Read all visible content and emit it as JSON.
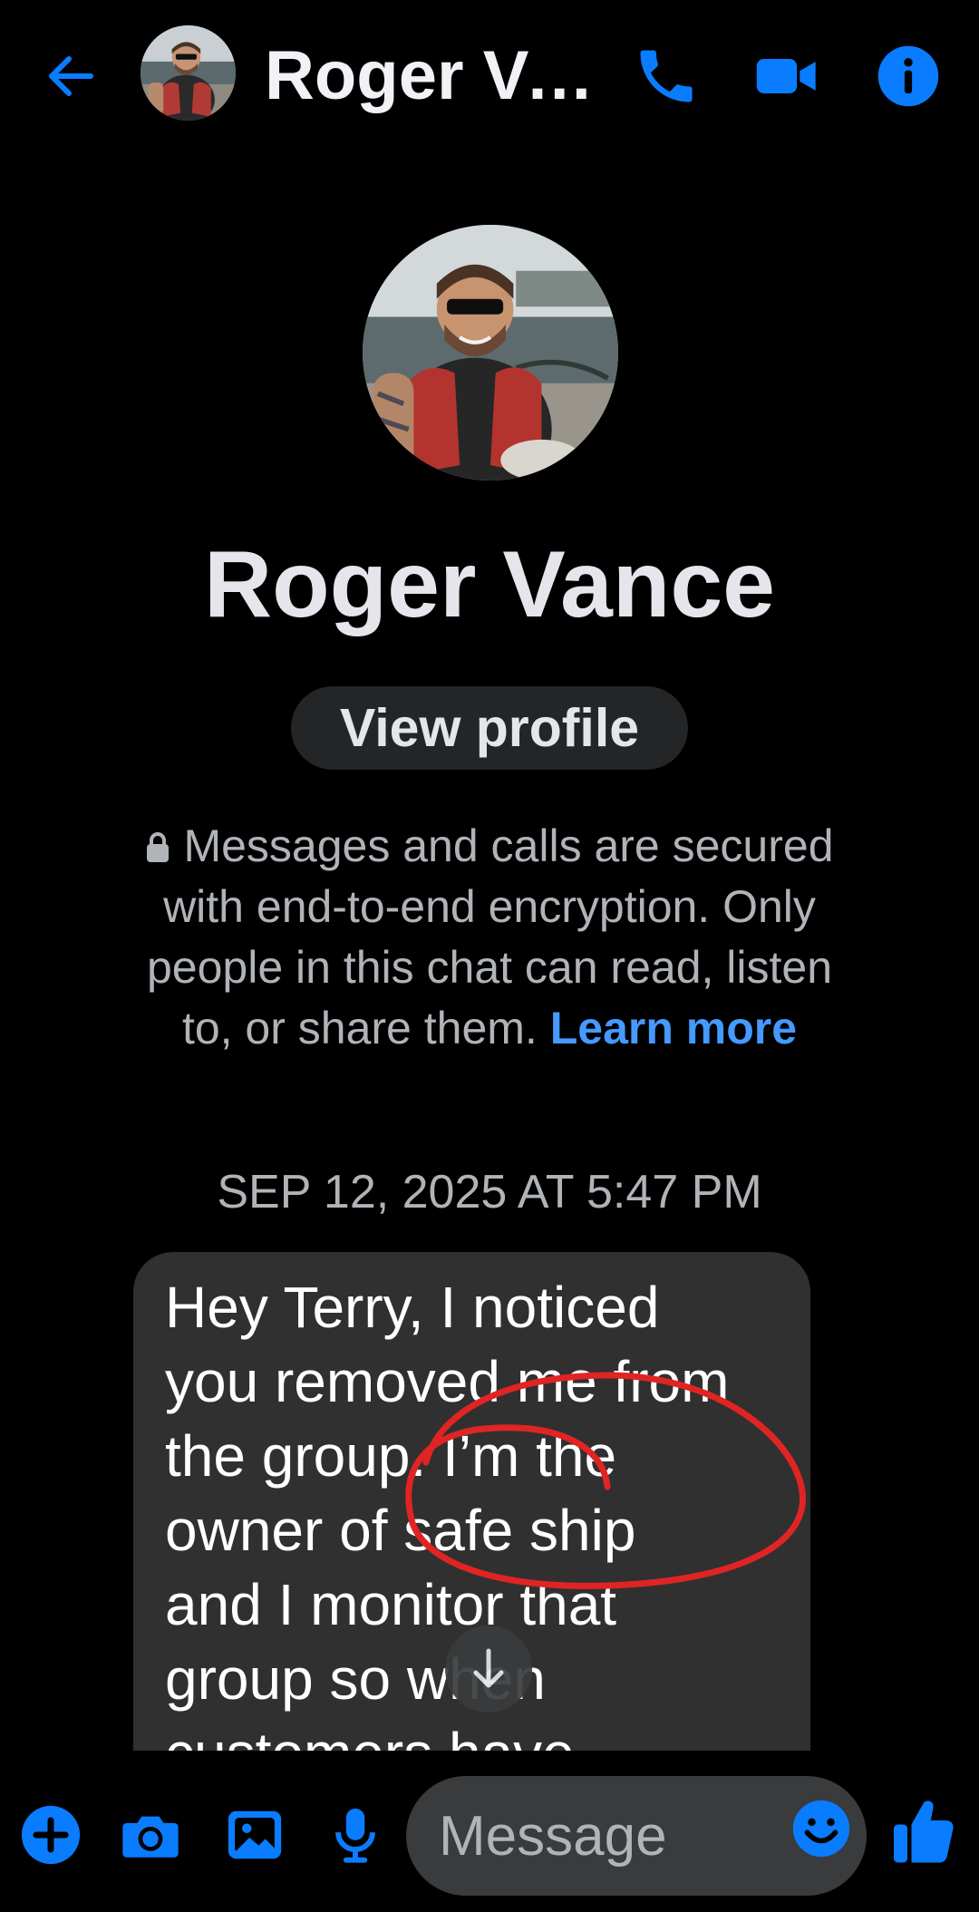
{
  "header": {
    "contact_name": "Roger Va...",
    "icons": [
      "back-arrow-icon",
      "avatar",
      "phone-icon",
      "video-camera-icon",
      "info-icon"
    ]
  },
  "profile": {
    "name": "Roger Vance",
    "view_profile_label": "View profile"
  },
  "encryption_notice": {
    "text": "Messages and calls are secured with end-to-end encryption. Only people in this chat can read, listen to, or share them.",
    "learn_more_label": "Learn more"
  },
  "conversation": {
    "timestamp": "SEP 12, 2025 AT 5:47 PM",
    "messages": [
      {
        "lines": [
          "Hey Terry, I noticed",
          "you removed me from",
          "the group. I’m the",
          "owner of safe ship",
          "and I monitor that",
          "group so when",
          "customers have"
        ]
      }
    ]
  },
  "composer": {
    "placeholder": "Message",
    "icons": [
      "plus-icon",
      "camera-icon",
      "gallery-icon",
      "microphone-icon",
      "emoji-icon",
      "thumbs-up-icon"
    ]
  },
  "colors": {
    "accent": "#0A7CFF",
    "background": "#000000",
    "bubble": "#303030",
    "link": "#4599FF",
    "annotation": "#E02424"
  }
}
